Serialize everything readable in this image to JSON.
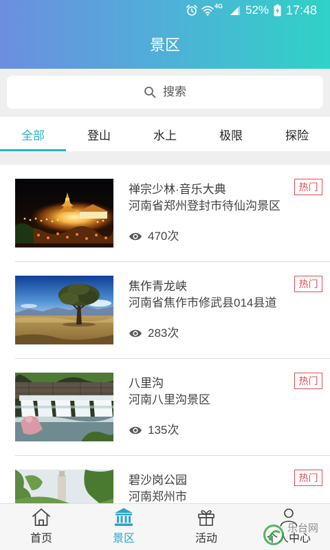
{
  "status_bar": {
    "network": "4G",
    "battery": "52%",
    "time": "17:48",
    "icons": [
      "alarm-icon",
      "wifi-icon",
      "signal-icon",
      "battery-charging-icon"
    ]
  },
  "header": {
    "title": "景区"
  },
  "search": {
    "placeholder": "搜索",
    "icon": "search-icon"
  },
  "tabs": [
    {
      "label": "全部",
      "active": true
    },
    {
      "label": "登山"
    },
    {
      "label": "水上"
    },
    {
      "label": "极限"
    },
    {
      "label": "探险"
    }
  ],
  "spots": [
    {
      "title": "禅宗少林·音乐大典",
      "address": "河南省郑州登封市待仙沟景区",
      "views": "470次",
      "badge": "热门"
    },
    {
      "title": "焦作青龙峡",
      "address": "河南省焦作市修武县014县道",
      "views": "283次",
      "badge": "热门"
    },
    {
      "title": "八里沟",
      "address": "河南八里沟景区",
      "views": "135次",
      "badge": "热门"
    },
    {
      "title": "碧沙岗公园",
      "address": "河南郑州市",
      "badge": "热门"
    }
  ],
  "bottom_nav": [
    {
      "label": "首页",
      "icon": "home-icon"
    },
    {
      "label": "景区",
      "icon": "temple-icon",
      "active": true
    },
    {
      "label": "活动",
      "icon": "gift-icon"
    },
    {
      "label": "个人中心",
      "icon": "user-icon"
    }
  ],
  "watermark": {
    "text": "乐台网"
  },
  "colors": {
    "header_gradient_start": "#6c8ee0",
    "header_gradient_end": "#2fd2c6",
    "accent": "#29b2bf",
    "badge": "#e34b4f",
    "nav_active": "#2aa6c9"
  }
}
